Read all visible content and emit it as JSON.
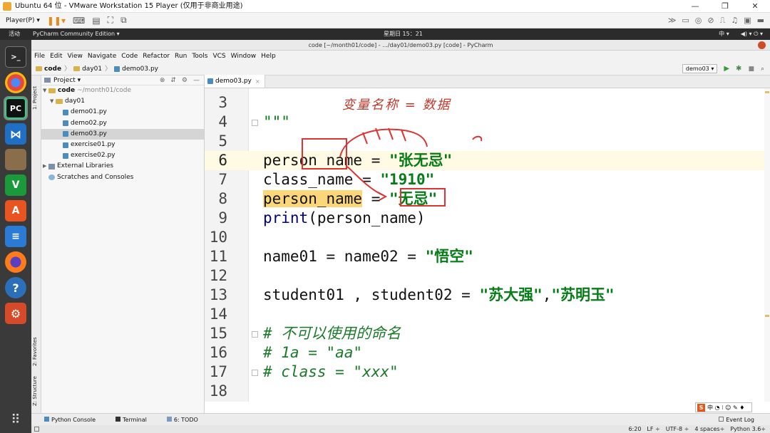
{
  "vmware": {
    "title": "Ubuntu 64 位 - VMware Workstation 15 Player (仅用于非商业用途)",
    "player_menu": "Player(P) ▾",
    "controls": [
      "—",
      "❐",
      "✕"
    ]
  },
  "ubuntu_panel": {
    "activities": "活动",
    "app_menu": "PyCharm Community Edition ▾",
    "clock": "星期日 15：21",
    "input_method": "中 ▾",
    "tray": "◀) ▾  ⏻ ▾"
  },
  "pycharm": {
    "window_title": "code [~/month01/code] - .../day01/demo03.py [code] - PyCharm",
    "menu": [
      "File",
      "Edit",
      "View",
      "Navigate",
      "Code",
      "Refactor",
      "Run",
      "Tools",
      "VCS",
      "Window",
      "Help"
    ],
    "breadcrumb": [
      "code",
      "day01",
      "demo03.py"
    ],
    "run_config": "demo03 ▾",
    "project_header": "Project ▾",
    "left_strip": {
      "project": "1: Project",
      "favorites": "2: Favorites",
      "structure": "Z: Structure"
    },
    "tree": {
      "root_name": "code",
      "root_path": "~/month01/code",
      "day01": "day01",
      "files": [
        "demo01.py",
        "demo02.py",
        "demo03.py",
        "exercise01.py",
        "exercise02.py"
      ],
      "selected_file": "demo03.py",
      "external": "External Libraries",
      "scratches": "Scratches and Consoles"
    },
    "tab": "demo03.py",
    "bottom_tools": {
      "python_console": "Python Console",
      "terminal": "Terminal",
      "todo": "6: TODO",
      "event_log": "Event Log"
    },
    "status": {
      "position": "6:20",
      "line_sep": "LF ÷",
      "encoding": "UTF-8 ÷",
      "indent": "4 spaces÷",
      "interpreter": "Python 3.6÷"
    },
    "ime_label": "中 ◔ ⁝ ☺ ✎ ♦"
  },
  "editor": {
    "line_numbers": [
      "3",
      "4",
      "5",
      "6",
      "7",
      "8",
      "9",
      "10",
      "11",
      "12",
      "13",
      "14",
      "15",
      "16",
      "17",
      "18"
    ],
    "current_line": "6",
    "annotation": "变量名称 = 数据",
    "line4": "\"\"\"",
    "line6_var": "person_name",
    "line6_op": " = ",
    "line6_str": "\"张无忌\"",
    "line7_var": "class_name",
    "line7_op": " = ",
    "line7_str": "\"1910\"",
    "line8_var": "person_name",
    "line8_op": " = ",
    "line8_str": "\"无忌\"",
    "line9_fn": "print",
    "line9_rest": "(person_name)",
    "line11_code": "name01 = name02 = ",
    "line11_str": "\"悟空\"",
    "line13_code": "student01 , student02 = ",
    "line13_str1": "\"苏大强\"",
    "line13_sep": ",",
    "line13_str2": "\"苏明玉\"",
    "line15": "# 不可以使用的命名",
    "line16": "# 1a = \"aa\"",
    "line17": "# class = \"xxx\""
  }
}
